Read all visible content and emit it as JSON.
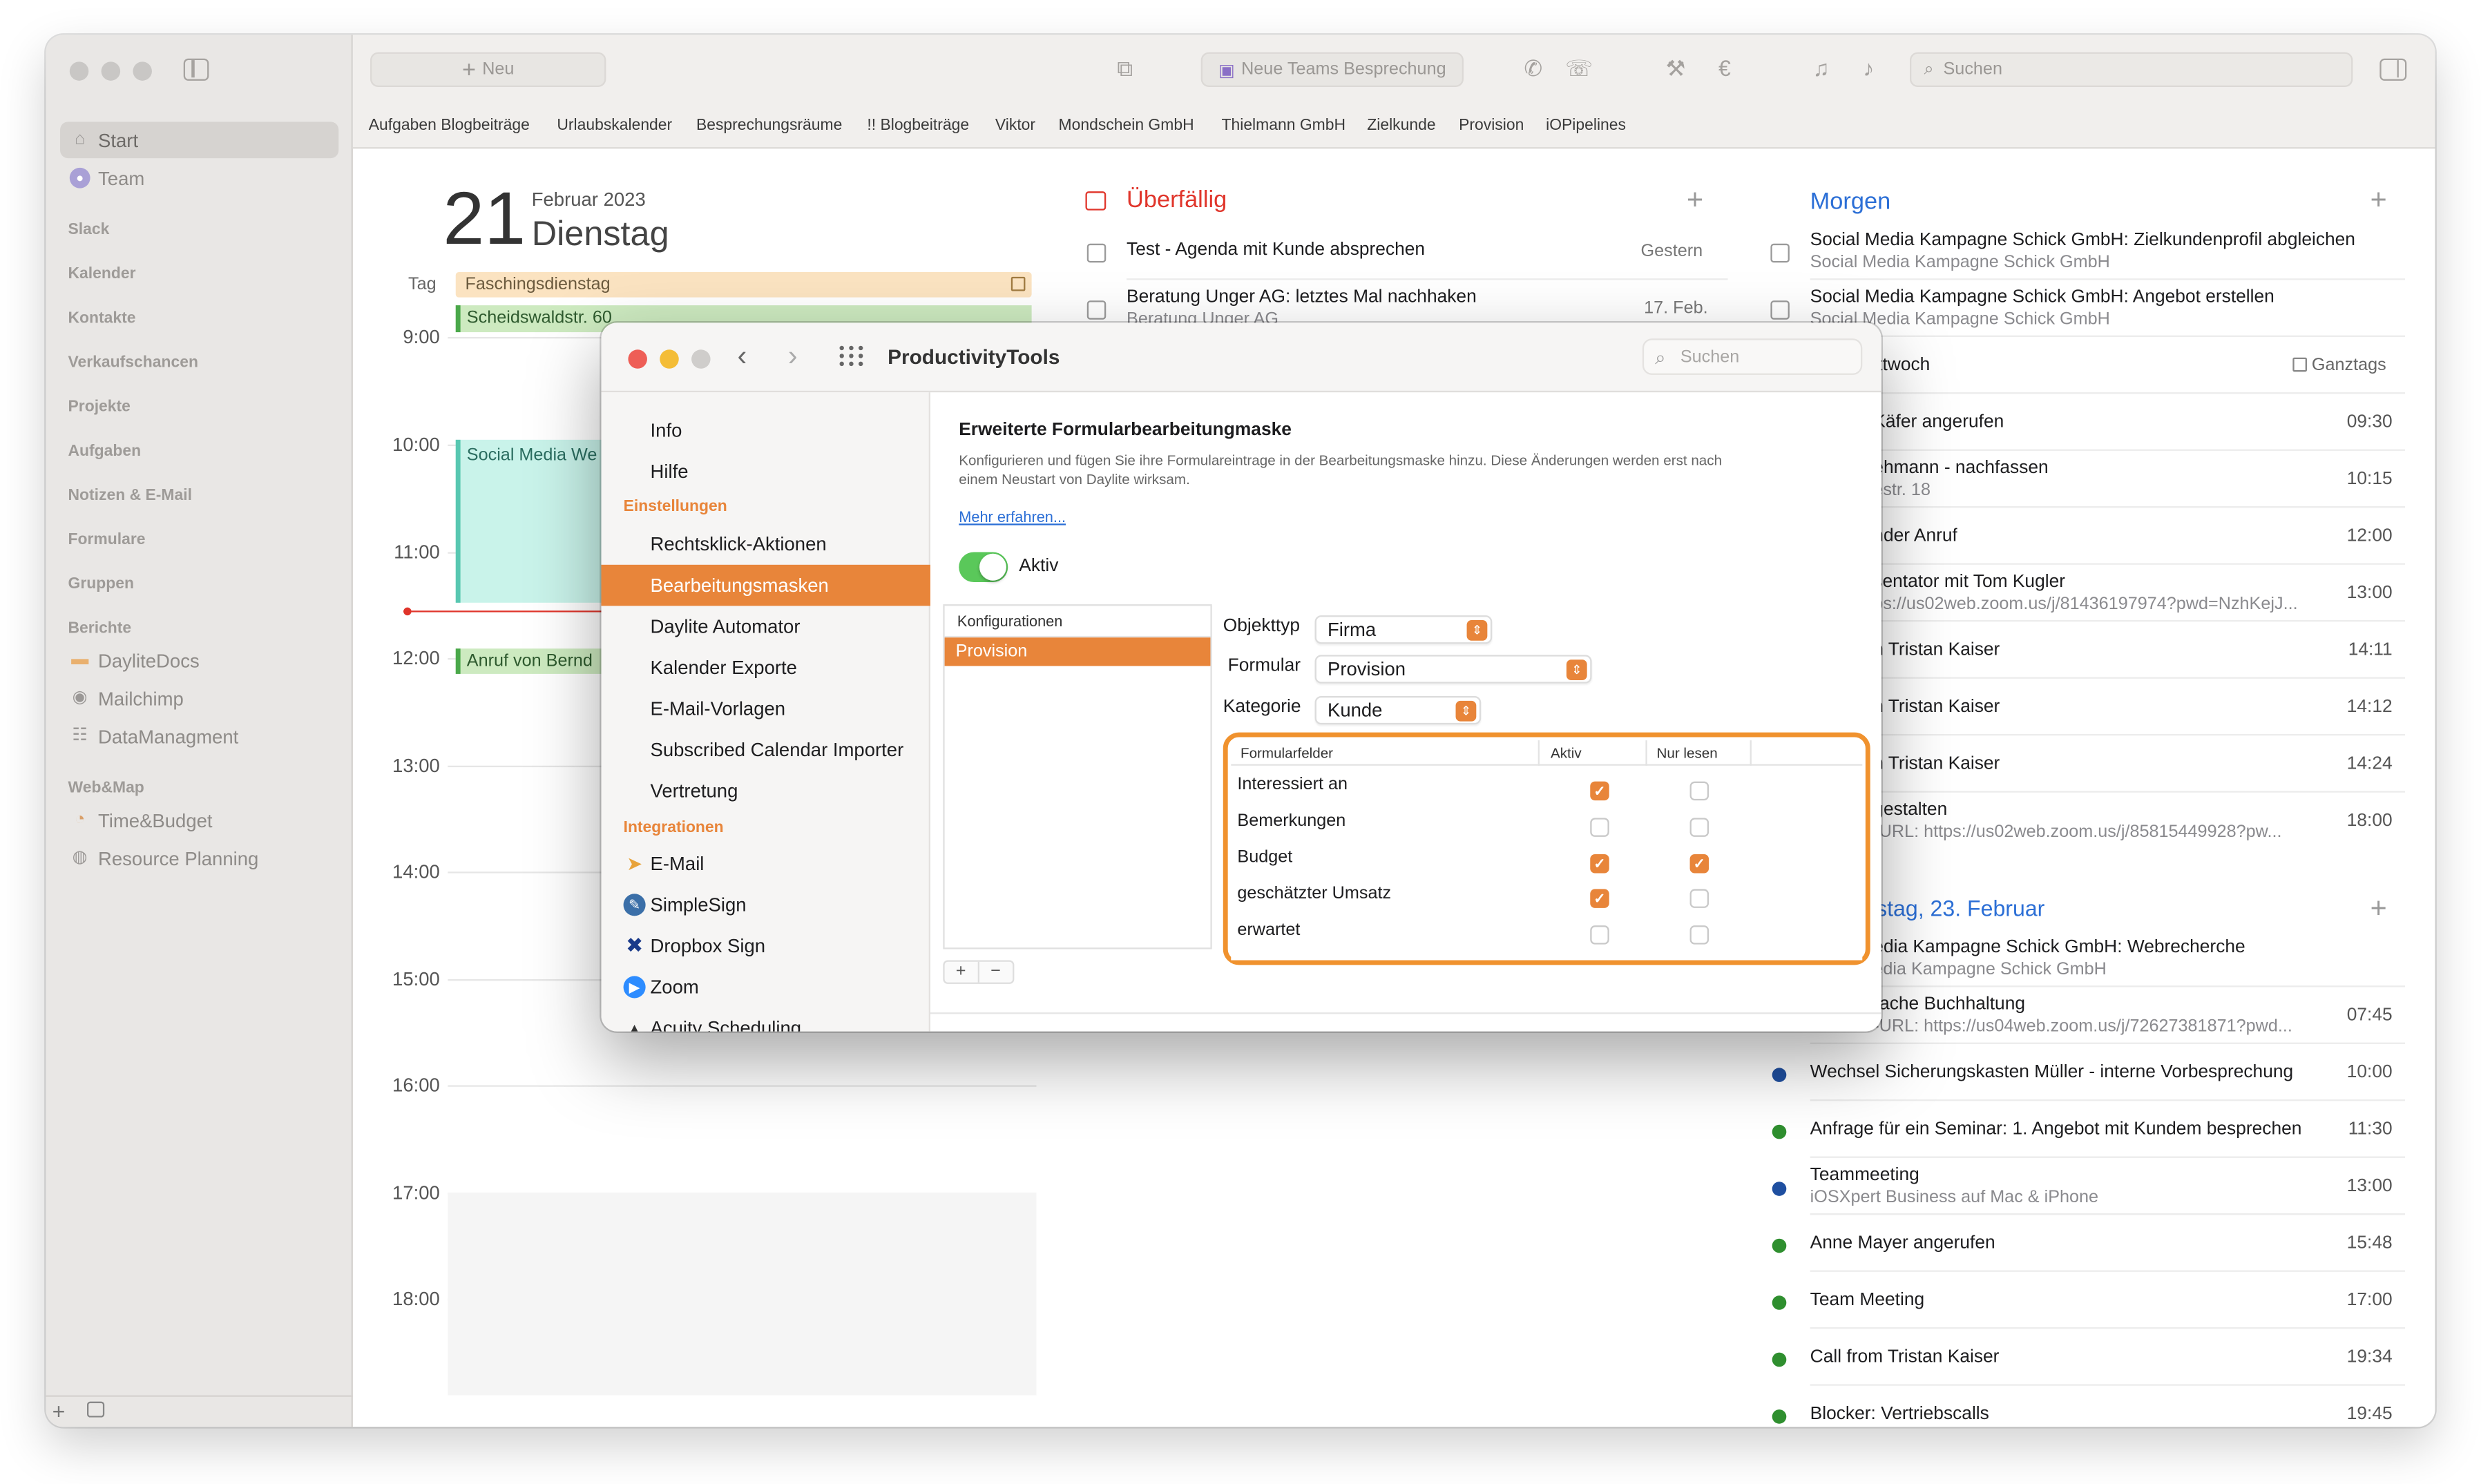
{
  "sidebar": {
    "items": [
      {
        "label": "Start",
        "icon": "home-icon",
        "selected": true
      },
      {
        "label": "Team",
        "icon": "team-icon",
        "selected": false
      }
    ],
    "sections": [
      "Slack",
      "Kalender",
      "Kontakte",
      "Verkaufschancen",
      "Projekte",
      "Aufgaben",
      "Notizen & E-Mail",
      "Formulare",
      "Gruppen"
    ],
    "berichte_label": "Berichte",
    "berichte_items": [
      "DayliteDocs",
      "Mailchimp",
      "DataManagment"
    ],
    "webmap_label": "Web&Map",
    "webmap_items": [
      "Time&Budget",
      "Resource Planning"
    ]
  },
  "toolbar": {
    "new_label": "Neu",
    "teams_label": "Neue Teams Besprechung",
    "search_placeholder": "Suchen",
    "favorites": [
      "Aufgaben Blogbeiträge",
      "Urlaubskalender",
      "Besprechungsräume",
      "!! Blogbeiträge",
      "Viktor",
      "Mondschein GmbH",
      "Thielmann GmbH",
      "Zielkunde",
      "Provision",
      "iOPipelines"
    ]
  },
  "calendar": {
    "day_number": "21",
    "month_year": "Februar 2023",
    "weekday": "Dienstag",
    "tag_label": "Tag",
    "allday_event": "Faschingsdienstag",
    "event_scheidswald": "Scheidswaldstr. 60",
    "event_social": "Social Media We",
    "event_anruf": "Anruf von Bernd",
    "hours": [
      "9:00",
      "10:00",
      "11:00",
      "12:00",
      "13:00",
      "14:00",
      "15:00",
      "16:00",
      "17:00",
      "18:00"
    ]
  },
  "overdue": {
    "title": "Überfällig",
    "rows": [
      {
        "title": "Test - Agenda mit Kunde absprechen",
        "sub": "",
        "date": "Gestern"
      },
      {
        "title": "Beratung Unger AG: letztes Mal nachhaken",
        "sub": "Beratung Unger AG",
        "date": "17. Feb."
      }
    ]
  },
  "tomorrow": {
    "title": "Morgen",
    "tasks": [
      {
        "title": "Social Media Kampagne Schick GmbH: Zielkundenprofil abgleichen",
        "sub": "Social Media Kampagne Schick GmbH"
      },
      {
        "title": "Social Media Kampagne Schick GmbH: Angebot erstellen",
        "sub": "Social Media Kampagne Schick GmbH"
      }
    ],
    "day_label": "ittwoch",
    "ganztags_label": "Ganztags",
    "events": [
      {
        "title": "Käfer angerufen",
        "sub": "",
        "time": "09:30"
      },
      {
        "title": "ehmann - nachfassen",
        "sub": "estr. 18",
        "time": "10:15"
      },
      {
        "title": "nder Anruf",
        "sub": "",
        "time": "12:00"
      },
      {
        "title": "sentator mit Tom Kugler",
        "sub": "ps://us02web.zoom.us/j/81436197974?pwd=NzhKejJ...",
        "time": "13:00"
      },
      {
        "title": "n Tristan Kaiser",
        "sub": "",
        "time": "14:11"
      },
      {
        "title": "n Tristan Kaiser",
        "sub": "",
        "time": "14:12"
      },
      {
        "title": "n Tristan Kaiser",
        "sub": "",
        "time": "14:24"
      },
      {
        "title": "gestalten",
        "sub": "-URL: https://us02web.zoom.us/j/85815449928?pw...",
        "time": "18:00"
      }
    ]
  },
  "thursday": {
    "title": "rstag, 23. Februar",
    "rows": [
      {
        "title": "edia Kampagne Schick GmbH: Webrecherche",
        "sub": "edia Kampagne Schick GmbH",
        "time": "",
        "dot": ""
      },
      {
        "title": "rache Buchhaltung",
        "sub": "-URL: https://us04web.zoom.us/j/72627381871?pwd...",
        "time": "07:45",
        "dot": ""
      },
      {
        "title": "Wechsel Sicherungskasten Müller - interne Vorbesprechung",
        "sub": "",
        "time": "10:00",
        "dot": "#1f4fa0"
      },
      {
        "title": "Anfrage für ein Seminar: 1. Angebot mit Kundem besprechen",
        "sub": "",
        "time": "11:30",
        "dot": "#2f8f2f"
      },
      {
        "title": "Teammeeting",
        "sub": "iOSXpert Business auf Mac & iPhone",
        "time": "13:00",
        "dot": "#1f4fa0"
      },
      {
        "title": "Anne Mayer angerufen",
        "sub": "",
        "time": "15:48",
        "dot": "#2f8f2f"
      },
      {
        "title": "Team Meeting",
        "sub": "",
        "time": "17:00",
        "dot": "#2f8f2f"
      },
      {
        "title": "Call from Tristan Kaiser",
        "sub": "",
        "time": "19:34",
        "dot": "#2f8f2f"
      },
      {
        "title": "Blocker: Vertriebscalls",
        "sub": "",
        "time": "19:45",
        "dot": "#2f8f2f"
      }
    ]
  },
  "dialog": {
    "title": "ProductivityTools",
    "search_placeholder": "Suchen",
    "nav_top": [
      "Info",
      "Hilfe"
    ],
    "settings_head": "Einstellungen",
    "settings_items": [
      "Rechtsklick-Aktionen",
      "Bearbeitungsmasken",
      "Daylite Automator",
      "Kalender Exporte",
      "E-Mail-Vorlagen",
      "Subscribed Calendar Importer",
      "Vertretung"
    ],
    "integrations_head": "Integrationen",
    "integrations": [
      {
        "label": "E-Mail",
        "icon": "email-icon"
      },
      {
        "label": "SimpleSign",
        "icon": "simplesign-icon"
      },
      {
        "label": "Dropbox Sign",
        "icon": "dropbox-icon"
      },
      {
        "label": "Zoom",
        "icon": "zoom-icon"
      },
      {
        "label": "Acuity Scheduling",
        "icon": "acuity-icon"
      }
    ],
    "content_title": "Erweiterte Formularbearbeitungmaske",
    "content_desc1": "Konfigurieren und fügen Sie ihre Formulareintrage in der Bearbeitungsmaske hinzu. Diese Änderungen werden erst nach",
    "content_desc2": "einem Neustart von Daylite wirksam.",
    "more_link": "Mehr erfahren...",
    "toggle_label": "Aktiv",
    "toggle_on": true,
    "configs_header": "Konfigurationen",
    "configs": [
      "Provision"
    ],
    "objekttyp_label": "Objekttyp",
    "objekttyp_value": "Firma",
    "formular_label": "Formular",
    "formular_value": "Provision",
    "kategorie_label": "Kategorie",
    "kategorie_value": "Kunde",
    "fields_col_name": "Formularfelder",
    "fields_col_active": "Aktiv",
    "fields_col_readonly": "Nur lesen",
    "fields": [
      {
        "name": "Interessiert an",
        "active": true,
        "readonly": false
      },
      {
        "name": "Bemerkungen",
        "active": false,
        "readonly": false
      },
      {
        "name": "Budget",
        "active": true,
        "readonly": true
      },
      {
        "name": "geschätzter Umsatz",
        "active": true,
        "readonly": false
      },
      {
        "name": "erwartet",
        "active": false,
        "readonly": false
      }
    ],
    "highlight_color": "#f0922e",
    "accent_color": "#e8853a"
  }
}
